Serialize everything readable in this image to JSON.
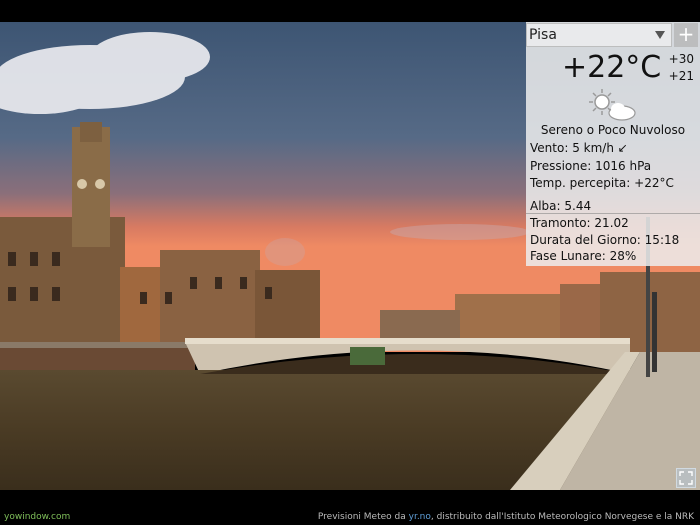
{
  "city": {
    "name": "Pisa"
  },
  "add_button": {
    "label": "+"
  },
  "current": {
    "temperature": "+22°C",
    "high": "+30",
    "low": "+21",
    "condition": "Sereno o Poco Nuvoloso",
    "icon": "partly-cloudy-icon"
  },
  "details": {
    "wind_label": "Vento:",
    "wind_value": "5 km/h",
    "wind_arrow": "↙",
    "pressure_label": "Pressione:",
    "pressure_value": "1016 hPa",
    "feels_label": "Temp. percepita:",
    "feels_value": "+22°C"
  },
  "astro": {
    "sunrise_label": "Alba:",
    "sunrise_value": "5.44",
    "sunset_label": "Tramonto:",
    "sunset_value": "21.02",
    "daylength_label": "Durata del Giorno:",
    "daylength_value": "15:18",
    "moon_label": "Fase Lunare:",
    "moon_value": "28%"
  },
  "footer": {
    "brand": "yowindow.com",
    "credit_prefix": "Previsioni Meteo da ",
    "credit_link": "yr.no",
    "credit_suffix": ", distribuito dall'Istituto Meteorologico Norvegese e la NRK"
  },
  "colors": {
    "sky_top": "#4f6a86",
    "sky_horizon": "#e9825f",
    "panel_bg": "#ececec",
    "brand": "#7fbf5a"
  }
}
